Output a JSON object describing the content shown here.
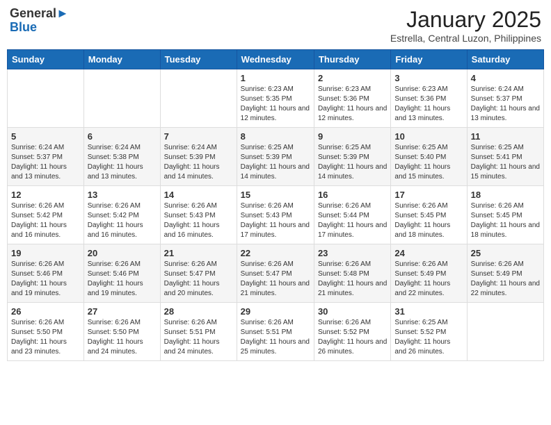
{
  "logo": {
    "general": "General",
    "blue": "Blue"
  },
  "title": "January 2025",
  "location": "Estrella, Central Luzon, Philippines",
  "days_of_week": [
    "Sunday",
    "Monday",
    "Tuesday",
    "Wednesday",
    "Thursday",
    "Friday",
    "Saturday"
  ],
  "weeks": [
    [
      {
        "day": "",
        "sunrise": "",
        "sunset": "",
        "daylight": ""
      },
      {
        "day": "",
        "sunrise": "",
        "sunset": "",
        "daylight": ""
      },
      {
        "day": "",
        "sunrise": "",
        "sunset": "",
        "daylight": ""
      },
      {
        "day": "1",
        "sunrise": "6:23 AM",
        "sunset": "5:35 PM",
        "daylight": "11 hours and 12 minutes."
      },
      {
        "day": "2",
        "sunrise": "6:23 AM",
        "sunset": "5:36 PM",
        "daylight": "11 hours and 12 minutes."
      },
      {
        "day": "3",
        "sunrise": "6:23 AM",
        "sunset": "5:36 PM",
        "daylight": "11 hours and 13 minutes."
      },
      {
        "day": "4",
        "sunrise": "6:24 AM",
        "sunset": "5:37 PM",
        "daylight": "11 hours and 13 minutes."
      }
    ],
    [
      {
        "day": "5",
        "sunrise": "6:24 AM",
        "sunset": "5:37 PM",
        "daylight": "11 hours and 13 minutes."
      },
      {
        "day": "6",
        "sunrise": "6:24 AM",
        "sunset": "5:38 PM",
        "daylight": "11 hours and 13 minutes."
      },
      {
        "day": "7",
        "sunrise": "6:24 AM",
        "sunset": "5:39 PM",
        "daylight": "11 hours and 14 minutes."
      },
      {
        "day": "8",
        "sunrise": "6:25 AM",
        "sunset": "5:39 PM",
        "daylight": "11 hours and 14 minutes."
      },
      {
        "day": "9",
        "sunrise": "6:25 AM",
        "sunset": "5:39 PM",
        "daylight": "11 hours and 14 minutes."
      },
      {
        "day": "10",
        "sunrise": "6:25 AM",
        "sunset": "5:40 PM",
        "daylight": "11 hours and 15 minutes."
      },
      {
        "day": "11",
        "sunrise": "6:25 AM",
        "sunset": "5:41 PM",
        "daylight": "11 hours and 15 minutes."
      }
    ],
    [
      {
        "day": "12",
        "sunrise": "6:26 AM",
        "sunset": "5:42 PM",
        "daylight": "11 hours and 16 minutes."
      },
      {
        "day": "13",
        "sunrise": "6:26 AM",
        "sunset": "5:42 PM",
        "daylight": "11 hours and 16 minutes."
      },
      {
        "day": "14",
        "sunrise": "6:26 AM",
        "sunset": "5:43 PM",
        "daylight": "11 hours and 16 minutes."
      },
      {
        "day": "15",
        "sunrise": "6:26 AM",
        "sunset": "5:43 PM",
        "daylight": "11 hours and 17 minutes."
      },
      {
        "day": "16",
        "sunrise": "6:26 AM",
        "sunset": "5:44 PM",
        "daylight": "11 hours and 17 minutes."
      },
      {
        "day": "17",
        "sunrise": "6:26 AM",
        "sunset": "5:45 PM",
        "daylight": "11 hours and 18 minutes."
      },
      {
        "day": "18",
        "sunrise": "6:26 AM",
        "sunset": "5:45 PM",
        "daylight": "11 hours and 18 minutes."
      }
    ],
    [
      {
        "day": "19",
        "sunrise": "6:26 AM",
        "sunset": "5:46 PM",
        "daylight": "11 hours and 19 minutes."
      },
      {
        "day": "20",
        "sunrise": "6:26 AM",
        "sunset": "5:46 PM",
        "daylight": "11 hours and 19 minutes."
      },
      {
        "day": "21",
        "sunrise": "6:26 AM",
        "sunset": "5:47 PM",
        "daylight": "11 hours and 20 minutes."
      },
      {
        "day": "22",
        "sunrise": "6:26 AM",
        "sunset": "5:47 PM",
        "daylight": "11 hours and 21 minutes."
      },
      {
        "day": "23",
        "sunrise": "6:26 AM",
        "sunset": "5:48 PM",
        "daylight": "11 hours and 21 minutes."
      },
      {
        "day": "24",
        "sunrise": "6:26 AM",
        "sunset": "5:49 PM",
        "daylight": "11 hours and 22 minutes."
      },
      {
        "day": "25",
        "sunrise": "6:26 AM",
        "sunset": "5:49 PM",
        "daylight": "11 hours and 22 minutes."
      }
    ],
    [
      {
        "day": "26",
        "sunrise": "6:26 AM",
        "sunset": "5:50 PM",
        "daylight": "11 hours and 23 minutes."
      },
      {
        "day": "27",
        "sunrise": "6:26 AM",
        "sunset": "5:50 PM",
        "daylight": "11 hours and 24 minutes."
      },
      {
        "day": "28",
        "sunrise": "6:26 AM",
        "sunset": "5:51 PM",
        "daylight": "11 hours and 24 minutes."
      },
      {
        "day": "29",
        "sunrise": "6:26 AM",
        "sunset": "5:51 PM",
        "daylight": "11 hours and 25 minutes."
      },
      {
        "day": "30",
        "sunrise": "6:26 AM",
        "sunset": "5:52 PM",
        "daylight": "11 hours and 26 minutes."
      },
      {
        "day": "31",
        "sunrise": "6:25 AM",
        "sunset": "5:52 PM",
        "daylight": "11 hours and 26 minutes."
      },
      {
        "day": "",
        "sunrise": "",
        "sunset": "",
        "daylight": ""
      }
    ]
  ]
}
